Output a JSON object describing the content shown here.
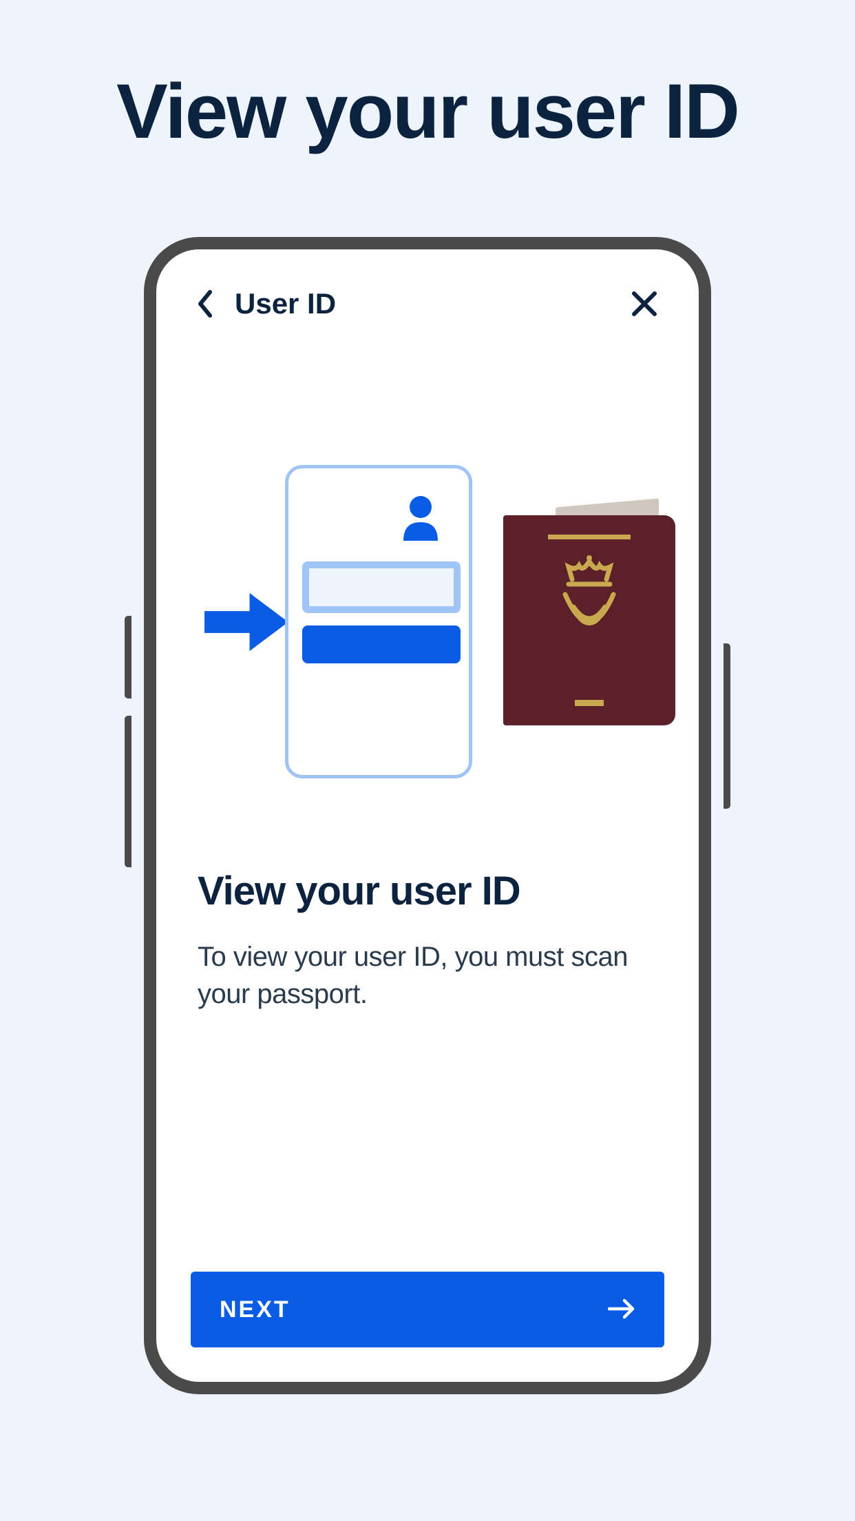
{
  "page": {
    "title": "View your user ID"
  },
  "phone": {
    "nav": {
      "title": "User ID"
    },
    "content": {
      "heading": "View your user ID",
      "body": "To view your user ID, you must scan your passport."
    },
    "button": {
      "next_label": "NEXT"
    }
  },
  "colors": {
    "background": "#eef4fb",
    "dark_navy": "#0c2340",
    "blue_primary": "#0a5ce5",
    "blue_light": "#a1c4f7",
    "passport_cover": "#5c2028",
    "passport_gold": "#c9a94f",
    "frame_grey": "#4a4a4a"
  }
}
